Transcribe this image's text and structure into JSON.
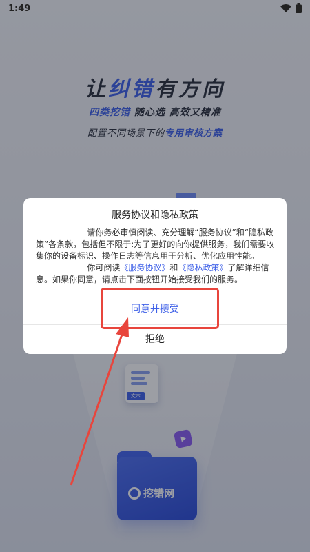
{
  "status_bar": {
    "time": "1:49"
  },
  "hero": {
    "title_pre": "让",
    "title_accent": "纠错",
    "title_post": "有方向",
    "tagline_accent": "四类挖错",
    "tagline_rest": " 随心选 高效又精准",
    "sub_pre": "配置不同场景下的",
    "sub_accent": "专用审核方案"
  },
  "illustration": {
    "doc_tag": "文本",
    "folder_label": "挖错网"
  },
  "dialog": {
    "title": "服务协议和隐私政策",
    "para1": "请你务必审慎阅读、充分理解“服务协议”和“隐私政策”各条款，包括但不限于:为了更好的向你提供服务，我们需要收集你的设备标识、操作日志等信息用于分析、优化应用性能。",
    "para2_pre": "你可阅读",
    "service_link": "《服务协议》",
    "para2_and": "和",
    "privacy_link": "《隐私政策》",
    "para2_post": "了解详细信息。如果你同意，请点击下面按钮开始接受我们的服务。",
    "accept_label": "同意并接受",
    "reject_label": "拒绝"
  },
  "colors": {
    "accent": "#3f61e8",
    "annotation": "#e8453c"
  }
}
